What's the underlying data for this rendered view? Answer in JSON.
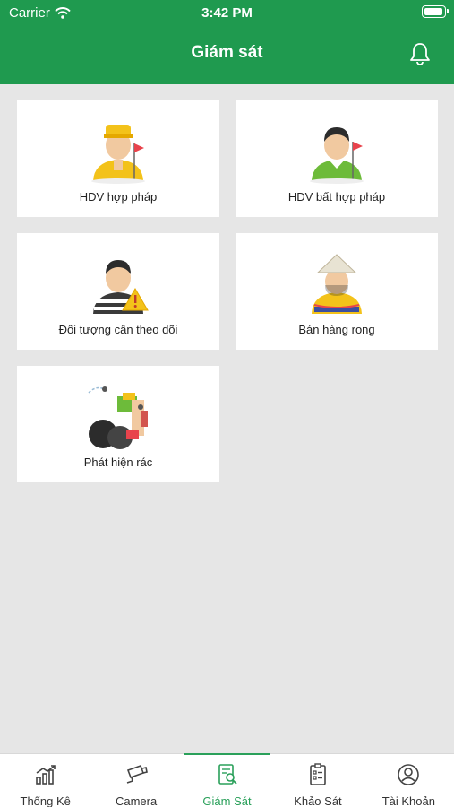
{
  "status_bar": {
    "carrier": "Carrier",
    "time": "3:42 PM"
  },
  "header": {
    "title": "Giám sát",
    "icon": "bell-icon"
  },
  "cards": [
    {
      "label": "HDV hợp pháp",
      "icon": "legal-guide-icon"
    },
    {
      "label": "HDV bất hợp pháp",
      "icon": "illegal-guide-icon"
    },
    {
      "label": "Đối tượng cần theo dõi",
      "icon": "watch-subject-icon"
    },
    {
      "label": "Bán hàng rong",
      "icon": "street-vendor-icon"
    },
    {
      "label": "Phát hiện rác",
      "icon": "trash-detection-icon"
    }
  ],
  "tabs": [
    {
      "label": "Thống Kê",
      "icon": "stats-icon"
    },
    {
      "label": "Camera",
      "icon": "camera-icon"
    },
    {
      "label": "Giám Sát",
      "icon": "monitor-icon",
      "active": true
    },
    {
      "label": "Khảo Sát",
      "icon": "survey-icon"
    },
    {
      "label": "Tài Khoản",
      "icon": "account-icon"
    }
  ],
  "colors": {
    "primary": "#1f9a4f",
    "active_tab": "#2aa05a",
    "background": "#e6e6e6"
  }
}
